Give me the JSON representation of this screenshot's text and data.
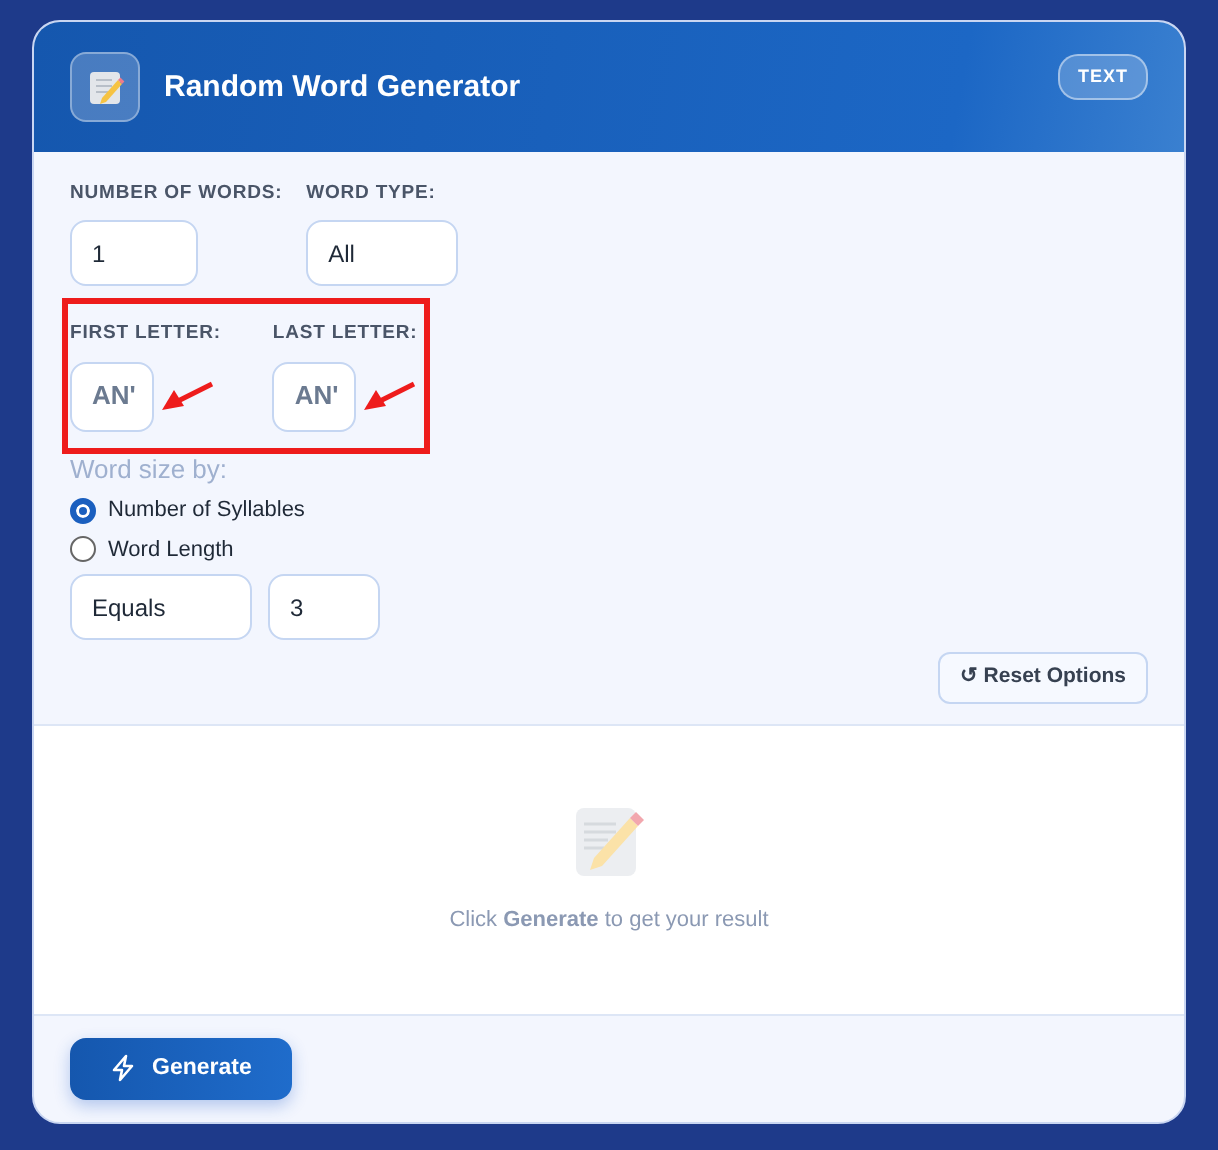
{
  "header": {
    "title": "Random Word Generator",
    "badge": "TEXT"
  },
  "fields": [
    {
      "label": "NUMBER OF WORDS:",
      "value": "1"
    },
    {
      "label": "WORD TYPE:",
      "value": "All"
    }
  ],
  "letters": {
    "highlighted": true,
    "fields": [
      {
        "label": "FIRST LETTER:",
        "value": "AN'"
      },
      {
        "label": "LAST LETTER:",
        "value": "AN'"
      }
    ]
  },
  "size": {
    "label": "Word size by:",
    "options": [
      {
        "label": "Number of Syllables",
        "selected": true
      },
      {
        "label": "Word Length",
        "selected": false
      }
    ],
    "comparison": "Equals",
    "amount": "3"
  },
  "reset_button": "↺ Reset Options",
  "result": {
    "message": "Click **Generate** to get your result"
  },
  "generate_button": "Generate"
}
